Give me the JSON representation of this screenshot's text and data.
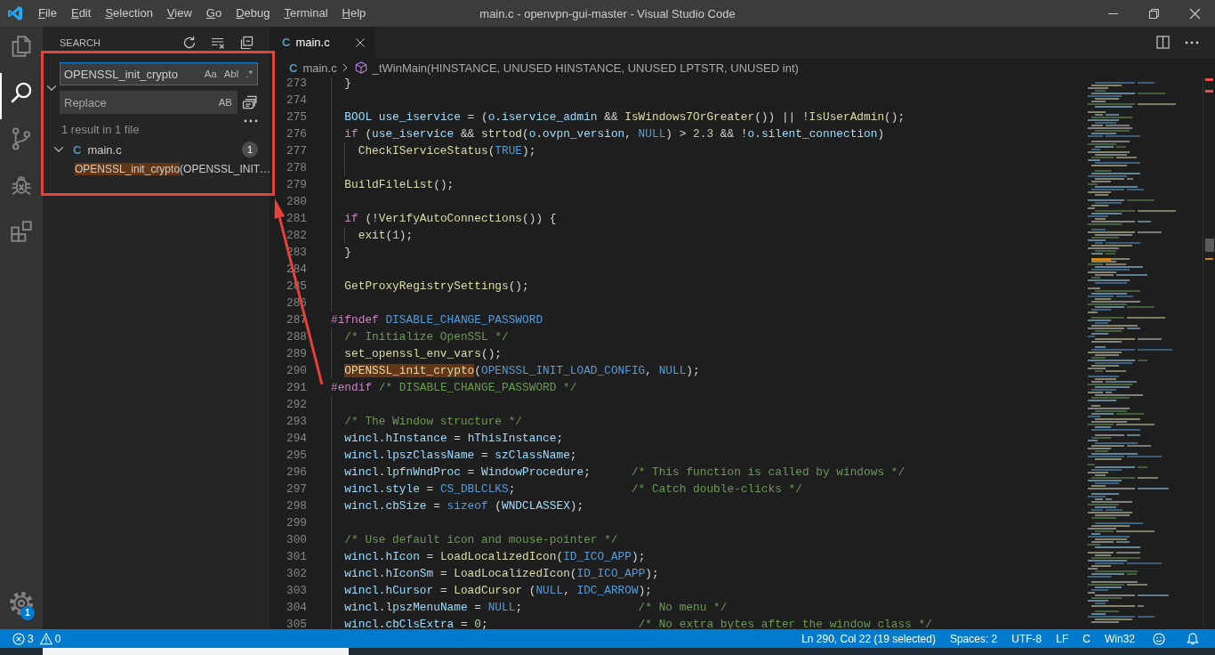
{
  "title_bar": {
    "menus": [
      "File",
      "Edit",
      "Selection",
      "View",
      "Go",
      "Debug",
      "Terminal",
      "Help"
    ],
    "title": "main.c - openvpn-gui-master - Visual Studio Code"
  },
  "activity_bar": {
    "items": [
      {
        "kind": "explorer",
        "selected": false
      },
      {
        "kind": "search",
        "selected": true
      },
      {
        "kind": "source_control",
        "selected": false
      },
      {
        "kind": "debug",
        "selected": false
      },
      {
        "kind": "extensions",
        "selected": false
      }
    ],
    "manage": {
      "badge": "1"
    }
  },
  "sidebar": {
    "title": "SEARCH",
    "replace_expanded": true,
    "search": {
      "value": "OPENSSL_init_crypto",
      "focused": true,
      "options": [
        {
          "label": "Aa",
          "on": false
        },
        {
          "label": "Abl",
          "on": false
        },
        {
          "label": ".*",
          "on": false
        }
      ]
    },
    "replace": {
      "placeholder": "Replace",
      "options": [
        {
          "label": "AB",
          "on": false
        }
      ]
    },
    "summary": "1 result in 1 file",
    "results": [
      {
        "icon": "C",
        "file": "main.c",
        "expanded": true,
        "count": "1",
        "matches": [
          {
            "match": "OPENSSL_init_crypto",
            "after": "(OPENSSL_INIT…"
          }
        ]
      }
    ]
  },
  "editor": {
    "tabs": [
      {
        "icon": "C",
        "label": "main.c",
        "selected": true
      }
    ],
    "breadcrumb": {
      "icon": "C",
      "file": "main.c",
      "symbol": "_tWinMain(HINSTANCE, UNUSED HINSTANCE, UNUSED LPTSTR, UNUSED int)"
    },
    "lines": [
      {
        "number": "273",
        "tokens": [
          {
            "kind": "punct",
            "text": "  }"
          }
        ]
      },
      {
        "number": "274"
      },
      {
        "number": "275",
        "tokens": [
          {
            "kind": "var",
            "text": "  BOOL "
          },
          {
            "kind": "var",
            "text": "use_iservice"
          },
          {
            "kind": "punct",
            "text": " = ("
          },
          {
            "kind": "var",
            "text": "o"
          },
          {
            "kind": "punct",
            "text": "."
          },
          {
            "kind": "var",
            "text": "iservice_admin"
          },
          {
            "kind": "punct",
            "text": " && "
          },
          {
            "kind": "fn",
            "text": "IsWindows7OrGreater"
          },
          {
            "kind": "punct",
            "text": "()) || !"
          },
          {
            "kind": "fn",
            "text": "IsUserAdmin"
          },
          {
            "kind": "punct",
            "text": "();"
          }
        ]
      },
      {
        "number": "276",
        "tokens": [
          {
            "kind": "kw",
            "text": "  if"
          },
          {
            "kind": "punct",
            "text": " ("
          },
          {
            "kind": "var",
            "text": "use_iservice"
          },
          {
            "kind": "punct",
            "text": " && "
          },
          {
            "kind": "fn",
            "text": "strtod"
          },
          {
            "kind": "punct",
            "text": "("
          },
          {
            "kind": "var",
            "text": "o"
          },
          {
            "kind": "punct",
            "text": "."
          },
          {
            "kind": "var",
            "text": "ovpn_version"
          },
          {
            "kind": "punct",
            "text": ", "
          },
          {
            "kind": "const",
            "text": "NULL"
          },
          {
            "kind": "punct",
            "text": ") > "
          },
          {
            "kind": "num",
            "text": "2.3"
          },
          {
            "kind": "punct",
            "text": " && !"
          },
          {
            "kind": "var",
            "text": "o"
          },
          {
            "kind": "punct",
            "text": "."
          },
          {
            "kind": "var",
            "text": "silent_connection"
          },
          {
            "kind": "punct",
            "text": ")"
          }
        ]
      },
      {
        "number": "277",
        "tokens": [
          {
            "kind": "fn",
            "text": "    CheckIServiceStatus"
          },
          {
            "kind": "punct",
            "text": "("
          },
          {
            "kind": "const",
            "text": "TRUE"
          },
          {
            "kind": "punct",
            "text": ");"
          }
        ]
      },
      {
        "number": "278"
      },
      {
        "number": "279",
        "tokens": [
          {
            "kind": "fn",
            "text": "  BuildFileList"
          },
          {
            "kind": "punct",
            "text": "();"
          }
        ]
      },
      {
        "number": "280"
      },
      {
        "number": "281",
        "tokens": [
          {
            "kind": "kw",
            "text": "  if"
          },
          {
            "kind": "punct",
            "text": " (!"
          },
          {
            "kind": "fn",
            "text": "VerifyAutoConnections"
          },
          {
            "kind": "punct",
            "text": "()) {"
          }
        ]
      },
      {
        "number": "282",
        "tokens": [
          {
            "kind": "fn",
            "text": "    exit"
          },
          {
            "kind": "punct",
            "text": "("
          },
          {
            "kind": "num",
            "text": "1"
          },
          {
            "kind": "punct",
            "text": ");"
          }
        ]
      },
      {
        "number": "283",
        "tokens": [
          {
            "kind": "punct",
            "text": "  }"
          }
        ]
      },
      {
        "number": "284"
      },
      {
        "number": "285",
        "tokens": [
          {
            "kind": "fn",
            "text": "  GetProxyRegistrySettings"
          },
          {
            "kind": "punct",
            "text": "();"
          }
        ]
      },
      {
        "number": "286"
      },
      {
        "number": "287",
        "tokens": [
          {
            "kind": "kw",
            "text": "#ifndef "
          },
          {
            "kind": "const",
            "text": "DISABLE_CHANGE_PASSWORD"
          }
        ]
      },
      {
        "number": "288",
        "tokens": [
          {
            "kind": "comment",
            "text": "  /* Initialize OpenSSL */"
          }
        ]
      },
      {
        "number": "289",
        "tokens": [
          {
            "kind": "fn",
            "text": "  set_openssl_env_vars"
          },
          {
            "kind": "punct",
            "text": "();"
          }
        ]
      },
      {
        "number": "290",
        "tokens": [
          {
            "kind": "fn",
            "text": "  OPENSSL_init_crypto",
            "match": true
          },
          {
            "kind": "punct",
            "text": "("
          },
          {
            "kind": "const",
            "text": "OPENSSL_INIT_LOAD_CONFIG"
          },
          {
            "kind": "punct",
            "text": ", "
          },
          {
            "kind": "const",
            "text": "NULL"
          },
          {
            "kind": "punct",
            "text": ");"
          }
        ]
      },
      {
        "number": "291",
        "tokens": [
          {
            "kind": "kw",
            "text": "#endif "
          },
          {
            "kind": "comment",
            "text": "/* DISABLE_CHANGE_PASSWORD */"
          }
        ]
      },
      {
        "number": "292"
      },
      {
        "number": "293",
        "tokens": [
          {
            "kind": "comment",
            "text": "  /* The Window structure */"
          }
        ]
      },
      {
        "number": "294",
        "tokens": [
          {
            "kind": "var",
            "text": "  wincl"
          },
          {
            "kind": "punct",
            "text": "."
          },
          {
            "kind": "var",
            "text": "hInstance"
          },
          {
            "kind": "punct",
            "text": " = "
          },
          {
            "kind": "var",
            "text": "hThisInstance"
          },
          {
            "kind": "punct",
            "text": ";"
          }
        ]
      },
      {
        "number": "295",
        "tokens": [
          {
            "kind": "var",
            "text": "  wincl"
          },
          {
            "kind": "punct",
            "text": "."
          },
          {
            "kind": "var",
            "text": "lpszClassName"
          },
          {
            "kind": "punct",
            "text": " = "
          },
          {
            "kind": "var",
            "text": "szClassName"
          },
          {
            "kind": "punct",
            "text": ";"
          }
        ]
      },
      {
        "number": "296",
        "tokens": [
          {
            "kind": "var",
            "text": "  wincl"
          },
          {
            "kind": "punct",
            "text": "."
          },
          {
            "kind": "var",
            "text": "lpfnWndProc"
          },
          {
            "kind": "punct",
            "text": " = "
          },
          {
            "kind": "var",
            "text": "WindowProcedure"
          },
          {
            "kind": "punct",
            "text": ";      "
          },
          {
            "kind": "comment",
            "text": "/* This function is called by windows */"
          }
        ]
      },
      {
        "number": "297",
        "tokens": [
          {
            "kind": "var",
            "text": "  wincl"
          },
          {
            "kind": "punct",
            "text": "."
          },
          {
            "kind": "var",
            "text": "style"
          },
          {
            "kind": "punct",
            "text": " = "
          },
          {
            "kind": "const",
            "text": "CS_DBLCLKS"
          },
          {
            "kind": "punct",
            "text": ";                 "
          },
          {
            "kind": "comment",
            "text": "/* Catch double-clicks */"
          }
        ]
      },
      {
        "number": "298",
        "tokens": [
          {
            "kind": "var",
            "text": "  wincl"
          },
          {
            "kind": "punct",
            "text": "."
          },
          {
            "kind": "var",
            "text": "cbSize"
          },
          {
            "kind": "punct",
            "text": " = "
          },
          {
            "kind": "const",
            "text": "sizeof"
          },
          {
            "kind": "punct",
            "text": " ("
          },
          {
            "kind": "var",
            "text": "WNDCLASSEX"
          },
          {
            "kind": "punct",
            "text": ");"
          }
        ]
      },
      {
        "number": "299"
      },
      {
        "number": "300",
        "tokens": [
          {
            "kind": "comment",
            "text": "  /* Use default icon and mouse-pointer */"
          }
        ]
      },
      {
        "number": "301",
        "tokens": [
          {
            "kind": "var",
            "text": "  wincl"
          },
          {
            "kind": "punct",
            "text": "."
          },
          {
            "kind": "var",
            "text": "hIcon"
          },
          {
            "kind": "punct",
            "text": " = "
          },
          {
            "kind": "fn",
            "text": "LoadLocalizedIcon"
          },
          {
            "kind": "punct",
            "text": "("
          },
          {
            "kind": "const",
            "text": "ID_ICO_APP"
          },
          {
            "kind": "punct",
            "text": ");"
          }
        ]
      },
      {
        "number": "302",
        "tokens": [
          {
            "kind": "var",
            "text": "  wincl"
          },
          {
            "kind": "punct",
            "text": "."
          },
          {
            "kind": "var",
            "text": "hIconSm"
          },
          {
            "kind": "punct",
            "text": " = "
          },
          {
            "kind": "fn",
            "text": "LoadLocalizedIcon"
          },
          {
            "kind": "punct",
            "text": "("
          },
          {
            "kind": "const",
            "text": "ID_ICO_APP"
          },
          {
            "kind": "punct",
            "text": ");"
          }
        ]
      },
      {
        "number": "303",
        "tokens": [
          {
            "kind": "var",
            "text": "  wincl"
          },
          {
            "kind": "punct",
            "text": "."
          },
          {
            "kind": "var",
            "text": "hCursor"
          },
          {
            "kind": "punct",
            "text": " = "
          },
          {
            "kind": "fn",
            "text": "LoadCursor"
          },
          {
            "kind": "punct",
            "text": " ("
          },
          {
            "kind": "const",
            "text": "NULL"
          },
          {
            "kind": "punct",
            "text": ", "
          },
          {
            "kind": "const",
            "text": "IDC_ARROW"
          },
          {
            "kind": "punct",
            "text": ");"
          }
        ]
      },
      {
        "number": "304",
        "tokens": [
          {
            "kind": "var",
            "text": "  wincl"
          },
          {
            "kind": "punct",
            "text": "."
          },
          {
            "kind": "var",
            "text": "lpszMenuName"
          },
          {
            "kind": "punct",
            "text": " = "
          },
          {
            "kind": "const",
            "text": "NULL"
          },
          {
            "kind": "punct",
            "text": ";                 "
          },
          {
            "kind": "comment",
            "text": "/* No menu */"
          }
        ]
      },
      {
        "number": "305",
        "tokens": [
          {
            "kind": "var",
            "text": "  wincl"
          },
          {
            "kind": "punct",
            "text": "."
          },
          {
            "kind": "var",
            "text": "cbClsExtra"
          },
          {
            "kind": "punct",
            "text": " = "
          },
          {
            "kind": "num",
            "text": "0"
          },
          {
            "kind": "punct",
            "text": ";                      "
          },
          {
            "kind": "comment",
            "text": "/* No extra bytes after the window class */"
          }
        ]
      }
    ]
  },
  "status_bar": {
    "errors": "3",
    "warnings": "0",
    "items": [
      "Ln 290, Col 22 (19 selected)",
      "Spaces: 2",
      "UTF-8",
      "LF",
      "C",
      "Win32"
    ]
  },
  "annotation": {
    "frame": true,
    "arrow": true
  }
}
